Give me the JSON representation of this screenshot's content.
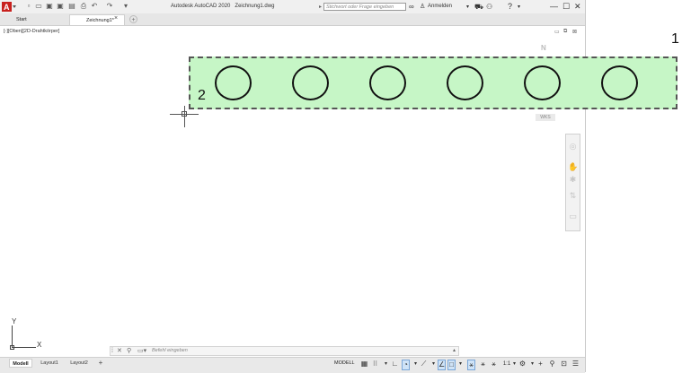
{
  "titlebar": {
    "app_title": "Autodesk AutoCAD 2020",
    "file_name": "Zeichnung1.dwg",
    "search_placeholder": "Stichwort oder Frage eingeben",
    "login_label": "Anmelden",
    "quick_access_icons": [
      "new-icon",
      "open-icon",
      "save-icon",
      "saveas-icon",
      "print-icon",
      "plot-icon",
      "undo-icon",
      "redo-icon",
      "customize-icon"
    ],
    "window_controls": {
      "minimize": "—",
      "maximize": "☐",
      "close": "✕"
    },
    "accent_color": "#c8211e"
  },
  "tabs": [
    {
      "label": "Start"
    },
    {
      "label": "Zeichnung1*",
      "active": true
    }
  ],
  "viewport": {
    "label": "[-][Oben][2D-Drahtkörper]",
    "compass_letter": "N",
    "wcs_label": "WKS"
  },
  "drawing": {
    "selection_fill": "#c6f6c6",
    "circle_count": 6,
    "markers": {
      "outer": "1",
      "inner": "2"
    }
  },
  "ucs": {
    "x_label": "X",
    "y_label": "Y"
  },
  "command_line": {
    "placeholder": "Befehl eingeben"
  },
  "layout_tabs": [
    {
      "label": "Modell",
      "active": true
    },
    {
      "label": "Layout1"
    },
    {
      "label": "Layout2"
    }
  ],
  "status": {
    "mode_label": "MODELL",
    "scale_label": "1:1"
  }
}
